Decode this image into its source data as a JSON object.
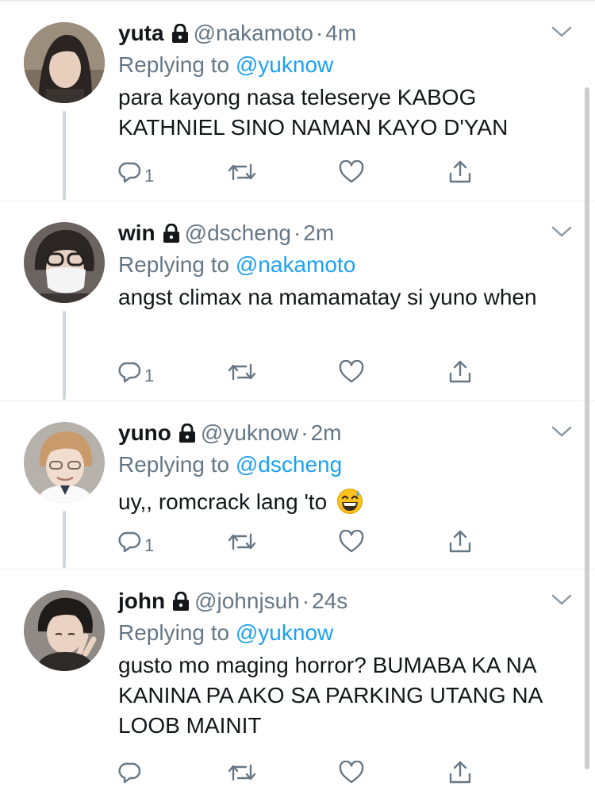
{
  "colors": {
    "text": "#14171a",
    "secondary": "#657786",
    "link": "#1da1f2",
    "thread_line": "#ccd6dd"
  },
  "icons": {
    "lock": "lock-icon",
    "chevron": "chevron-down-icon",
    "reply": "reply-icon",
    "retweet": "retweet-icon",
    "like": "heart-icon",
    "share": "share-icon"
  },
  "tweets": [
    {
      "name": "yuta",
      "handle": "@nakamoto",
      "separator": "·",
      "time": "4m",
      "replying_prefix": "Replying to",
      "replying_to": "@yuknow",
      "text": "para kayong nasa teleserye KABOG KATHNIEL SINO NAMAN KAYO D'YAN",
      "reply_count": "1"
    },
    {
      "name": "win",
      "handle": "@dscheng",
      "separator": "·",
      "time": "2m",
      "replying_prefix": "Replying to",
      "replying_to": "@nakamoto",
      "text": "angst climax na mamamatay si yuno when",
      "reply_count": "1"
    },
    {
      "name": "yuno",
      "handle": "@yuknow",
      "separator": "·",
      "time": "2m",
      "replying_prefix": "Replying to",
      "replying_to": "@dscheng",
      "text": "uy,, romcrack lang 'to",
      "emoji": "grinning-face-with-sweat",
      "reply_count": "1"
    },
    {
      "name": "john",
      "handle": "@johnjsuh",
      "separator": "·",
      "time": "24s",
      "replying_prefix": "Replying to",
      "replying_to": "@yuknow",
      "text": "gusto mo maging horror? BUMABA KA NA KANINA PA AKO SA PARKING UTANG NA LOOB MAINIT",
      "reply_count": ""
    }
  ]
}
